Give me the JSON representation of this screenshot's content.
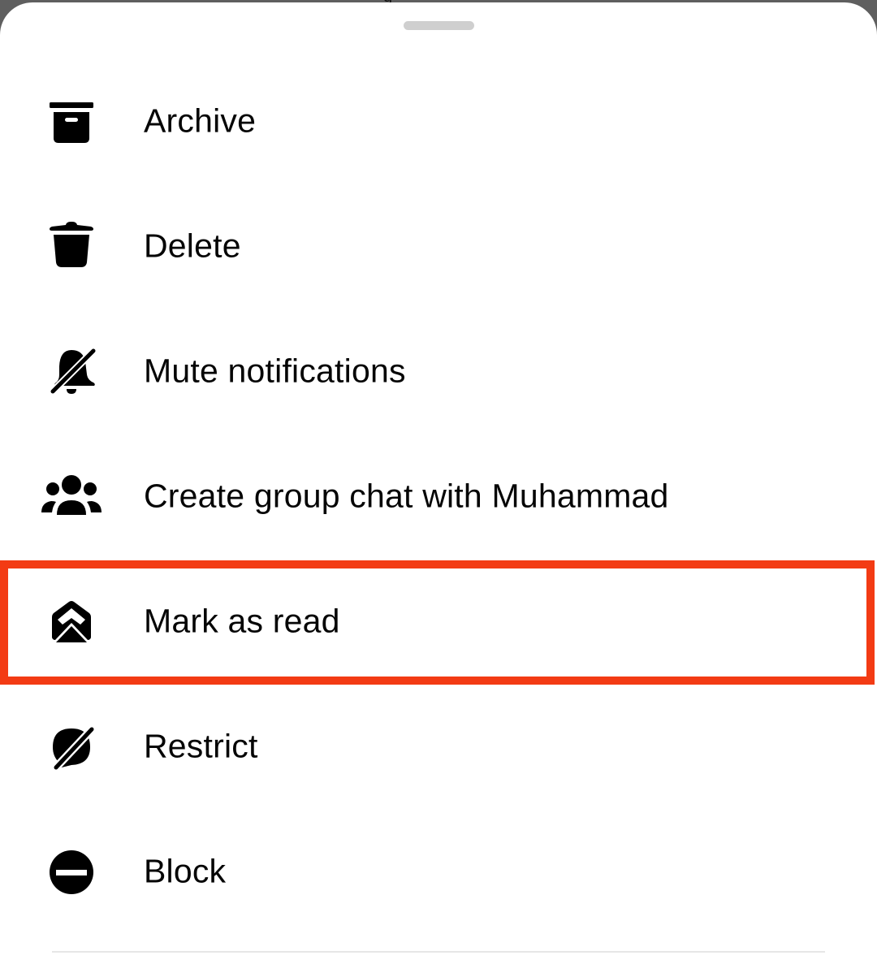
{
  "sheet": {
    "handle": "drag-handle",
    "highlight_color": "#f33b14",
    "highlighted_item": "Mark as read"
  },
  "menu": {
    "items": [
      {
        "label": "Archive",
        "icon": "archive-icon"
      },
      {
        "label": "Delete",
        "icon": "trash-icon"
      },
      {
        "label": "Mute notifications",
        "icon": "bell-off-icon"
      },
      {
        "label": "Create group chat with Muhammad",
        "icon": "group-icon"
      },
      {
        "label": "Mark as read",
        "icon": "envelope-open-icon"
      },
      {
        "label": "Restrict",
        "icon": "restrict-icon"
      },
      {
        "label": "Block",
        "icon": "block-icon"
      }
    ]
  }
}
